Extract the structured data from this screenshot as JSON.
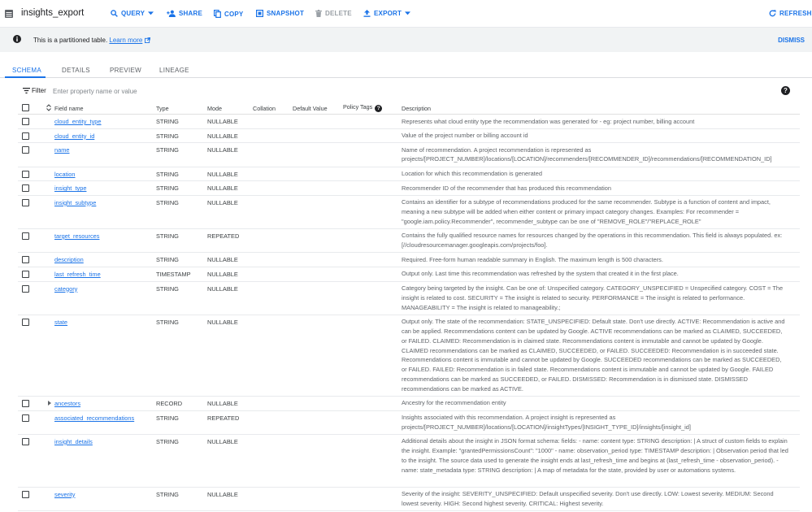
{
  "toolbar": {
    "title": "insights_export",
    "query": "QUERY",
    "share": "SHARE",
    "copy": "COPY",
    "snapshot": "SNAPSHOT",
    "delete": "DELETE",
    "export": "EXPORT",
    "refresh": "REFRESH"
  },
  "banner": {
    "text": "This is a partitioned table.",
    "link": "Learn more",
    "dismiss": "DISMISS"
  },
  "tabs": [
    "SCHEMA",
    "DETAILS",
    "PREVIEW",
    "LINEAGE"
  ],
  "filter": {
    "label": "Filter",
    "placeholder": "Enter property name or value"
  },
  "columns": {
    "field_name": "Field name",
    "type": "Type",
    "mode": "Mode",
    "collation": "Collation",
    "default_value": "Default Value",
    "policy_tags": "Policy Tags",
    "description": "Description"
  },
  "rows": [
    {
      "name": "cloud_entity_type",
      "type": "STRING",
      "mode": "NULLABLE",
      "description": "Represents what cloud entity type the recommendation was generated for - eg: project number, billing account"
    },
    {
      "name": "cloud_entity_id",
      "type": "STRING",
      "mode": "NULLABLE",
      "description": "Value of the project number or billing account id"
    },
    {
      "name": "name",
      "type": "STRING",
      "mode": "NULLABLE",
      "description": "Name of recommendation. A project recommendation is represented as projects/[PROJECT_NUMBER]/locations/[LOCATION]/recommenders/[RECOMMENDER_ID]/recommendations/[RECOMMENDATION_ID]"
    },
    {
      "name": "location",
      "type": "STRING",
      "mode": "NULLABLE",
      "description": "Location for which this recommendation is generated"
    },
    {
      "name": "insight_type",
      "type": "STRING",
      "mode": "NULLABLE",
      "description": "Recommender ID of the recommender that has produced this recommendation"
    },
    {
      "name": "insight_subtype",
      "type": "STRING",
      "mode": "NULLABLE",
      "description": "Contains an identifier for a subtype of recommendations produced for the same recommender. Subtype is a function of content and impact, meaning a new subtype will be added when either content or primary impact category changes. Examples: For recommender = \"google.iam.policy.Recommender\", recommender_subtype can be one of \"REMOVE_ROLE\"/\"REPLACE_ROLE\""
    },
    {
      "name": "target_resources",
      "type": "STRING",
      "mode": "REPEATED",
      "description": "Contains the fully qualified resource names for resources changed by the operations in this recommendation. This field is always populated. ex: [//cloudresourcemanager.googleapis.com/projects/foo]."
    },
    {
      "name": "description",
      "type": "STRING",
      "mode": "NULLABLE",
      "description": "Required. Free-form human readable summary in English. The maximum length is 500 characters."
    },
    {
      "name": "last_refresh_time",
      "type": "TIMESTAMP",
      "mode": "NULLABLE",
      "description": "Output only. Last time this recommendation was refreshed by the system that created it in the first place."
    },
    {
      "name": "category",
      "type": "STRING",
      "mode": "NULLABLE",
      "description": "Category being targeted by the insight. Can be one of: Unspecified category. CATEGORY_UNSPECIFIED = Unspecified category. COST = The insight is related to cost. SECURITY = The insight is related to security. PERFORMANCE = The insight is related to performance. MANAGEABILITY = The insight is related to manageability.;"
    },
    {
      "name": "state",
      "type": "STRING",
      "mode": "NULLABLE",
      "description": "Output only. The state of the recommendation: STATE_UNSPECIFIED: Default state. Don't use directly. ACTIVE: Recommendation is active and can be applied. Recommendations content can be updated by Google. ACTIVE recommendations can be marked as CLAIMED, SUCCEEDED, or FAILED. CLAIMED: Recommendation is in claimed state. Recommendations content is immutable and cannot be updated by Google. CLAIMED recommendations can be marked as CLAIMED, SUCCEEDED, or FAILED. SUCCEEDED: Recommendation is in succeeded state. Recommendations content is immutable and cannot be updated by Google. SUCCEEDED recommendations can be marked as SUCCEEDED, or FAILED. FAILED: Recommendation is in failed state. Recommendations content is immutable and cannot be updated by Google. FAILED recommendations can be marked as SUCCEEDED, or FAILED. DISMISSED: Recommendation is in dismissed state. DISMISSED recommendations can be marked as ACTIVE."
    },
    {
      "name": "ancestors",
      "type": "RECORD",
      "mode": "NULLABLE",
      "description": "Ancestry for the recommendation entity"
    },
    {
      "name": "associated_recommendations",
      "type": "STRING",
      "mode": "REPEATED",
      "description": "Insights associated with this recommendation. A project insight is represented as projects/[PROJECT_NUMBER]/locations/[LOCATION]/insightTypes/[INSIGHT_TYPE_ID]/insights/[insight_id]"
    },
    {
      "name": "insight_details",
      "type": "STRING",
      "mode": "NULLABLE",
      "description": "Additional details about the insight in JSON format schema: fields: - name: content type: STRING description: | A struct of custom fields to explain the insight. Example: \"grantedPermissionsCount\": \"1000\" - name: observation_period type: TIMESTAMP description: | Observation period that led to the insight. The source data used to generate the insight ends at last_refresh_time and begins at (last_refresh_time - observation_period). - name: state_metadata type: STRING description: | A map of metadata for the state, provided by user or automations systems."
    },
    {
      "name": "severity",
      "type": "STRING",
      "mode": "NULLABLE",
      "description": "Severity of the insight: SEVERITY_UNSPECIFIED: Default unspecified severity. Don't use directly. LOW: Lowest severity. MEDIUM: Second lowest severity. HIGH: Second highest severity. CRITICAL: Highest severity."
    }
  ]
}
